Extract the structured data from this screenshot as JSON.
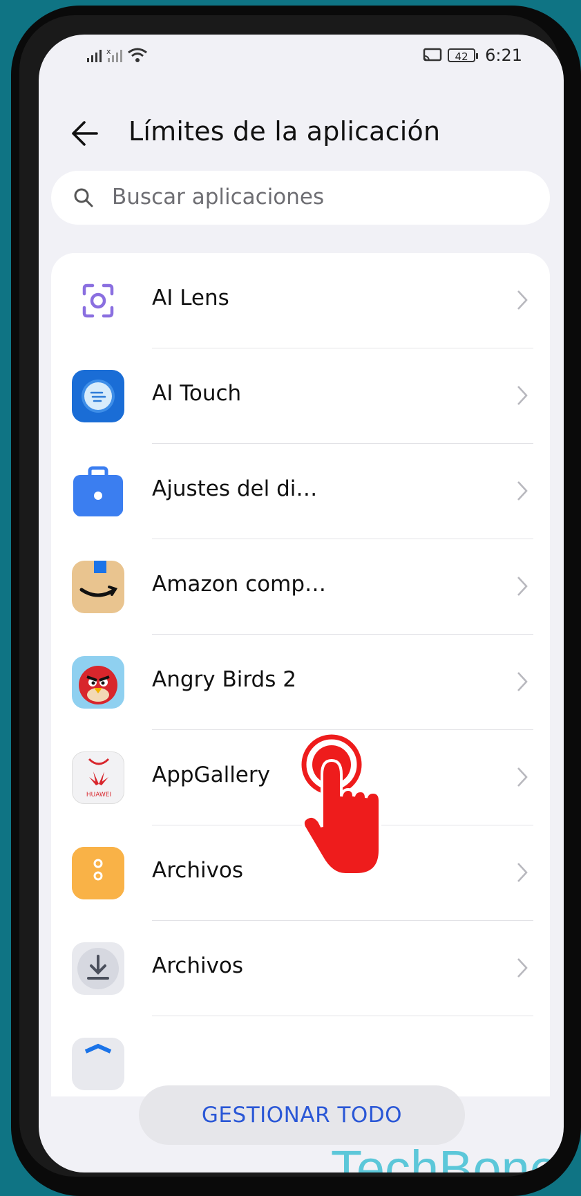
{
  "status_bar": {
    "time": "6:21",
    "battery": "42",
    "icons": [
      "signal-icon",
      "signal-x-icon",
      "wifi-icon",
      "cast-icon",
      "battery-icon"
    ]
  },
  "header": {
    "title": "Límites de la aplicación",
    "back_icon": "back-arrow-icon"
  },
  "search": {
    "placeholder": "Buscar aplicaciones"
  },
  "apps": [
    {
      "name": "AI Lens",
      "icon": "ai-lens-icon"
    },
    {
      "name": "AI Touch",
      "icon": "ai-touch-icon"
    },
    {
      "name": "Ajustes del di…",
      "icon": "briefcase-icon"
    },
    {
      "name": "Amazon comp…",
      "icon": "amazon-icon"
    },
    {
      "name": "Angry Birds 2",
      "icon": "angry-birds-icon"
    },
    {
      "name": "AppGallery",
      "icon": "huawei-appgallery-icon"
    },
    {
      "name": "Archivos",
      "icon": "folder-icon"
    },
    {
      "name": "Archivos",
      "icon": "download-icon"
    }
  ],
  "footer": {
    "button": "GESTIONAR TODO"
  },
  "watermark": "TechBone",
  "colors": {
    "accent": "#2a57d6",
    "background": "#0f7484",
    "screen": "#f1f1f6",
    "hand": "#ee1c1c"
  }
}
